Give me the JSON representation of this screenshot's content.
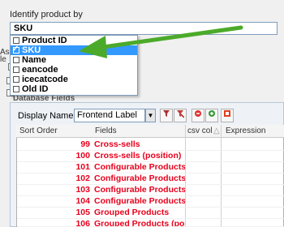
{
  "identify": {
    "label": "Identify product by",
    "selected": "SKU"
  },
  "side": {
    "as_label": "As",
    "le_label": "le"
  },
  "dropdown": {
    "items": [
      {
        "label": "Product ID",
        "checked": false,
        "selected": false
      },
      {
        "label": "SKU",
        "checked": true,
        "selected": true
      },
      {
        "label": "Name",
        "checked": false,
        "selected": false
      },
      {
        "label": "eancode",
        "checked": false,
        "selected": false
      },
      {
        "label": "icecatcode",
        "checked": false,
        "selected": false
      },
      {
        "label": "Old ID",
        "checked": false,
        "selected": false
      }
    ]
  },
  "db_fields": {
    "title": "Database Fields",
    "display_name_label": "Display Name as",
    "display_name_value": "Frontend Label",
    "toolbar_icons": [
      "filter-icon",
      "filter-remove-icon",
      "delete-icon",
      "add-icon",
      "export-icon"
    ]
  },
  "grid": {
    "headers": {
      "sort_order": "Sort Order",
      "fields": "Fields",
      "csv_col": "csv col",
      "sort_indicator": "△",
      "expression": "Expression"
    },
    "rows": [
      {
        "order": "99",
        "field": "Cross-sells"
      },
      {
        "order": "100",
        "field": "Cross-sells (position)"
      },
      {
        "order": "101",
        "field": "Configurable Products"
      },
      {
        "order": "102",
        "field": "Configurable Products (att"
      },
      {
        "order": "103",
        "field": "Configurable Products (att"
      },
      {
        "order": "104",
        "field": "Configurable Products (att"
      },
      {
        "order": "105",
        "field": "Grouped Products"
      },
      {
        "order": "106",
        "field": "Grouped Products (position"
      }
    ]
  },
  "colors": {
    "accent_selection": "#3399ff",
    "row_text": "#e8001c",
    "arrow": "#4caa2a"
  }
}
